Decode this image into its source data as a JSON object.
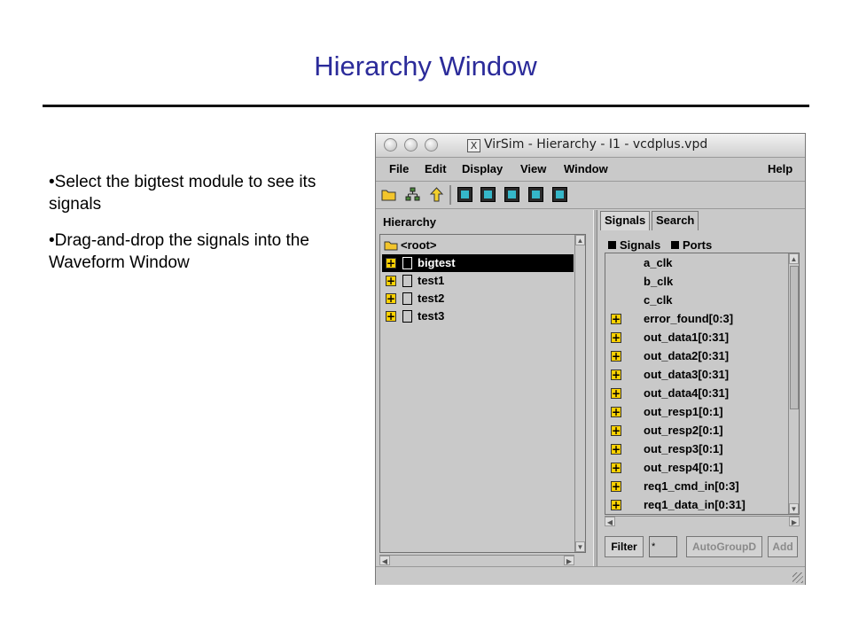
{
  "slide": {
    "title": "Hierarchy Window",
    "bullets": [
      "•Select the bigtest module to see its signals",
      "•Drag-and-drop the signals into the Waveform Window"
    ]
  },
  "window": {
    "title": "VirSim - Hierarchy - I1 - vcdplus.vpd",
    "x_logo": "X",
    "menus": [
      "File",
      "Edit",
      "Display",
      "View",
      "Window",
      "Help"
    ],
    "toolbar_icons": [
      "open-folder-icon",
      "hierarchy-tree-icon",
      "up-arrow-icon",
      "go-to-waveform-icon",
      "go-to-register-icon",
      "go-to-logic-icon",
      "go-to-source-icon",
      "go-to-list-icon"
    ]
  },
  "hierarchy": {
    "label": "Hierarchy",
    "root": "<root>",
    "items": [
      {
        "name": "bigtest",
        "selected": true
      },
      {
        "name": "test1",
        "selected": false
      },
      {
        "name": "test2",
        "selected": false
      },
      {
        "name": "test3",
        "selected": false
      }
    ]
  },
  "signals_pane": {
    "tabs": [
      "Signals",
      "Search"
    ],
    "active_tab": "Signals",
    "filters": [
      "Signals",
      "Ports"
    ],
    "signals": [
      {
        "name": "a_clk",
        "expandable": false
      },
      {
        "name": "b_clk",
        "expandable": false
      },
      {
        "name": "c_clk",
        "expandable": false
      },
      {
        "name": "error_found[0:3]",
        "expandable": true
      },
      {
        "name": "out_data1[0:31]",
        "expandable": true
      },
      {
        "name": "out_data2[0:31]",
        "expandable": true
      },
      {
        "name": "out_data3[0:31]",
        "expandable": true
      },
      {
        "name": "out_data4[0:31]",
        "expandable": true
      },
      {
        "name": "out_resp1[0:1]",
        "expandable": true
      },
      {
        "name": "out_resp2[0:1]",
        "expandable": true
      },
      {
        "name": "out_resp3[0:1]",
        "expandable": true
      },
      {
        "name": "out_resp4[0:1]",
        "expandable": true
      },
      {
        "name": "req1_cmd_in[0:3]",
        "expandable": true
      },
      {
        "name": "req1_data_in[0:31]",
        "expandable": true
      }
    ],
    "filter_button": "Filter",
    "filter_value": "*",
    "autogroup_button": "AutoGroupD",
    "add_button": "Add",
    "plus_glyph": "+"
  },
  "colors": {
    "title": "#2b2b9a",
    "plus_box": "#ffd200",
    "selection": "#000000",
    "toolbar_accent": "#35b7c9"
  }
}
